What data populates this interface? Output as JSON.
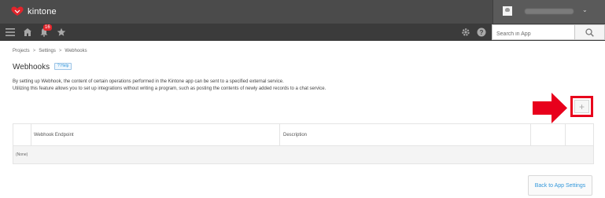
{
  "header": {
    "brand": "kintone",
    "brand_color": "#e2252c",
    "user_name_blurred": true
  },
  "nav": {
    "icons": [
      "menu-icon",
      "home-icon",
      "notification-icon",
      "favorites-icon",
      "settings-icon",
      "help-icon"
    ],
    "notification_count": "16",
    "search_placeholder": "Search in App"
  },
  "breadcrumb": {
    "items": [
      "Projects",
      "Settings",
      "Webhooks"
    ],
    "separator": ">"
  },
  "page": {
    "title": "Webhooks",
    "help_label": "? Help",
    "description_line1": "By setting up Webhook, the content of certain operations performed in the Kintone app can be sent to a specified external service.",
    "description_line2": "Utilizing this feature allows you to set up integrations without writing a program, such as posting the contents of newly added records to a chat service."
  },
  "add_button": {
    "label": "+",
    "highlight_color": "#e8001c"
  },
  "table": {
    "columns": [
      "",
      "Webhook Endpoint",
      "Description",
      "",
      ""
    ],
    "empty_text": "(None)"
  },
  "footer": {
    "back_label": "Back to App Settings"
  }
}
